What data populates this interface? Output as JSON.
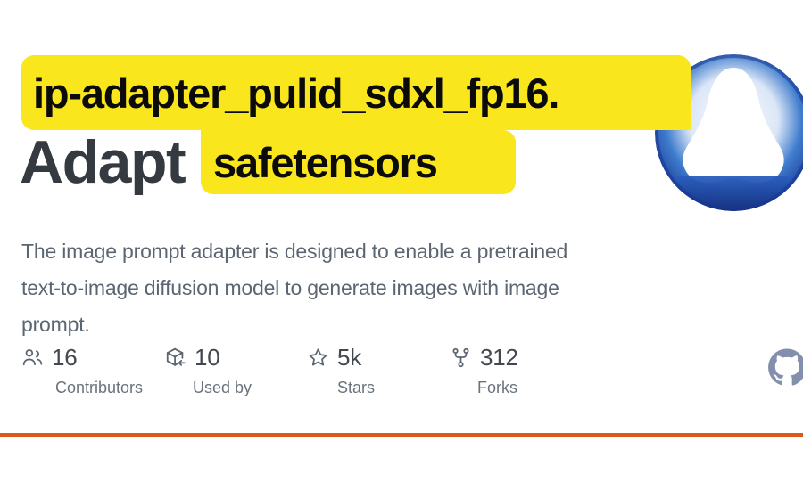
{
  "page": {
    "background_color": "#ffffff",
    "divider_color": "#d9581a"
  },
  "repo": {
    "title": "Adapt",
    "description": "The image prompt adapter is designed to enable a pretrained text-to-image diffusion model to generate images with image prompt."
  },
  "avatar": {
    "name": "org-avatar",
    "shape": "circular-gradient-logo",
    "gradient_outer": "#1b3f9e",
    "gradient_mid": "#2f6fc9",
    "inner_color": "#ffffff"
  },
  "highlight": {
    "color": "#fae61c",
    "text_color": "#0b0b0b",
    "line1": "ip-adapter_pulid_sdxl_fp16.",
    "line2": "safetensors",
    "full_text": "ip-adapter_pulid_sdxl_fp16.safetensors"
  },
  "stats": [
    {
      "icon": "people-icon",
      "value": "16",
      "label": "Contributors"
    },
    {
      "icon": "package-icon",
      "value": "10",
      "label": "Used by"
    },
    {
      "icon": "star-icon",
      "value": "5k",
      "label": "Stars"
    },
    {
      "icon": "fork-icon",
      "value": "312",
      "label": "Forks"
    }
  ],
  "brand": {
    "mark": "github-mark-icon",
    "color": "#8290ae"
  }
}
